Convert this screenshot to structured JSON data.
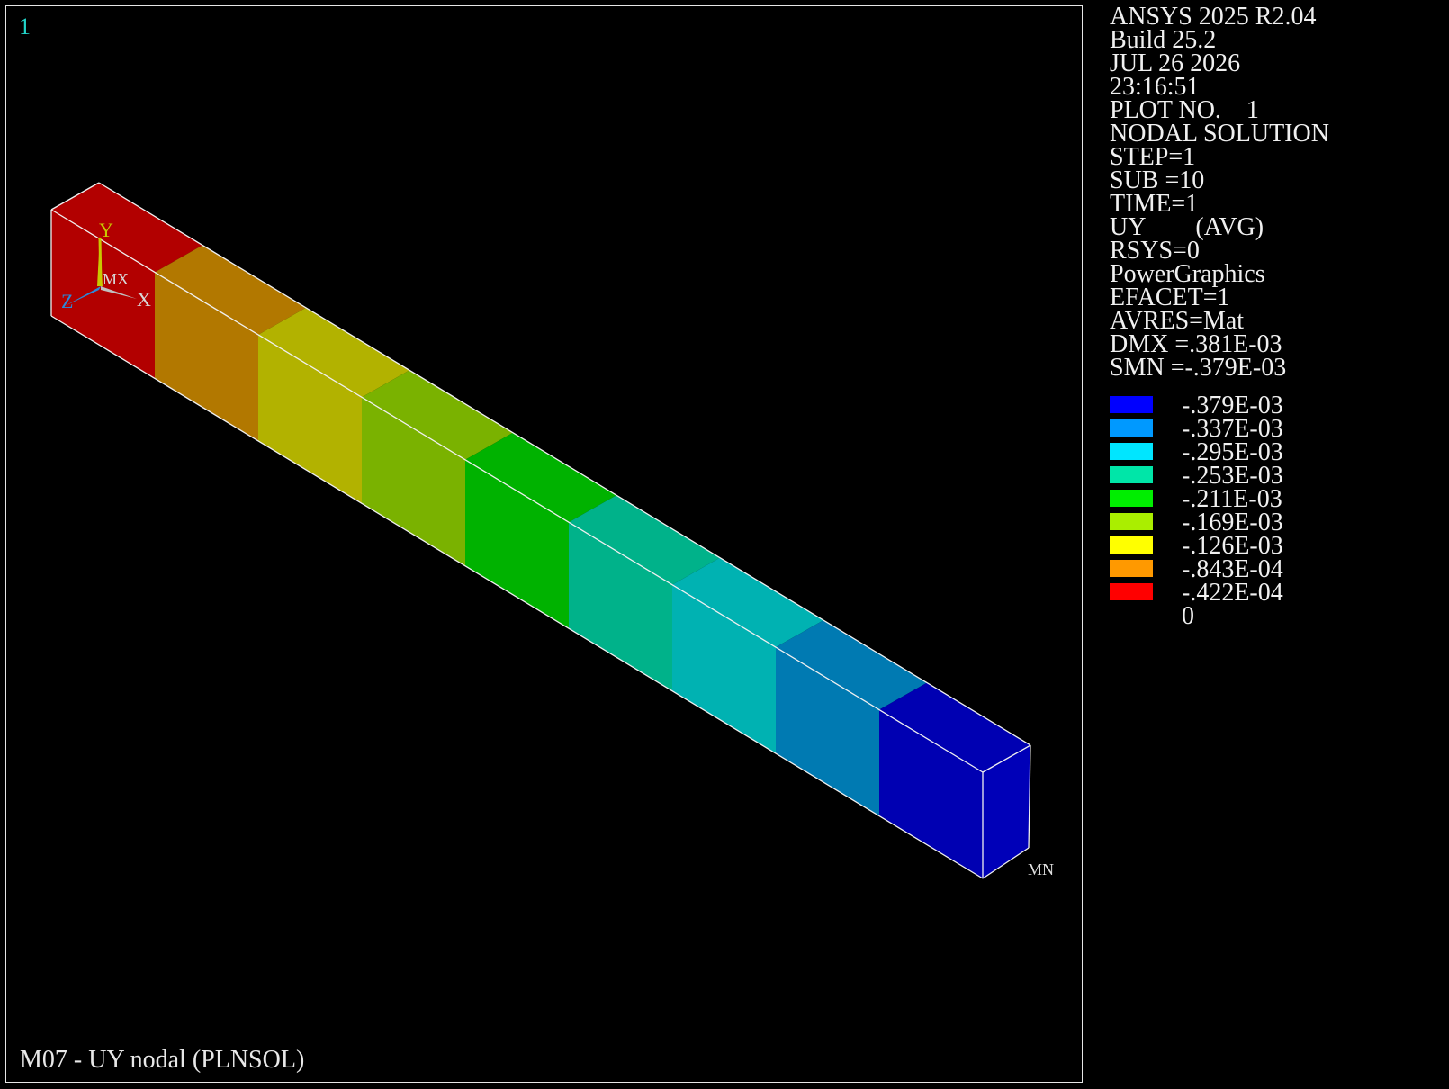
{
  "window_number": "1",
  "info": {
    "lines": [
      "ANSYS 2025 R2.04",
      "Build 25.2",
      "JUL 26 2026",
      "23:16:51",
      "PLOT NO.    1",
      "NODAL SOLUTION",
      "STEP=1",
      "SUB =10",
      "TIME=1",
      "UY        (AVG)",
      "RSYS=0",
      "PowerGraphics",
      "EFACET=1",
      "AVRES=Mat",
      "DMX =.381E-03",
      "SMN =-.379E-03"
    ]
  },
  "legend": [
    {
      "label": "-.379E-03",
      "color": "#0000ff"
    },
    {
      "label": "-.337E-03",
      "color": "#0099ff"
    },
    {
      "label": "-.295E-03",
      "color": "#00e6ff"
    },
    {
      "label": "-.253E-03",
      "color": "#00e6a8"
    },
    {
      "label": "-.211E-03",
      "color": "#00ee00"
    },
    {
      "label": "-.169E-03",
      "color": "#aaee00"
    },
    {
      "label": "-.126E-03",
      "color": "#ffff00"
    },
    {
      "label": "-.843E-04",
      "color": "#ff9900"
    },
    {
      "label": "-.422E-04",
      "color": "#ff0000"
    },
    {
      "label": "0",
      "color": ""
    }
  ],
  "beam_bands": {
    "side_colors": [
      "#b20000",
      "#b27800",
      "#b2b200",
      "#7ab200",
      "#00b200",
      "#00b28a",
      "#00b2b2",
      "#007ab2",
      "#0000b2"
    ],
    "top_colors": [
      "#b20000",
      "#b27800",
      "#b2b200",
      "#7ab200",
      "#00b200",
      "#00b28a",
      "#00b2b2",
      "#007ab2",
      "#0000b2"
    ]
  },
  "axis_triad": {
    "y_label": "Y",
    "z_label": "Z",
    "x_label": "X",
    "mx_label": "MX"
  },
  "min_marker": "MN",
  "plot_title": "M07 - UY nodal (PLNSOL)"
}
